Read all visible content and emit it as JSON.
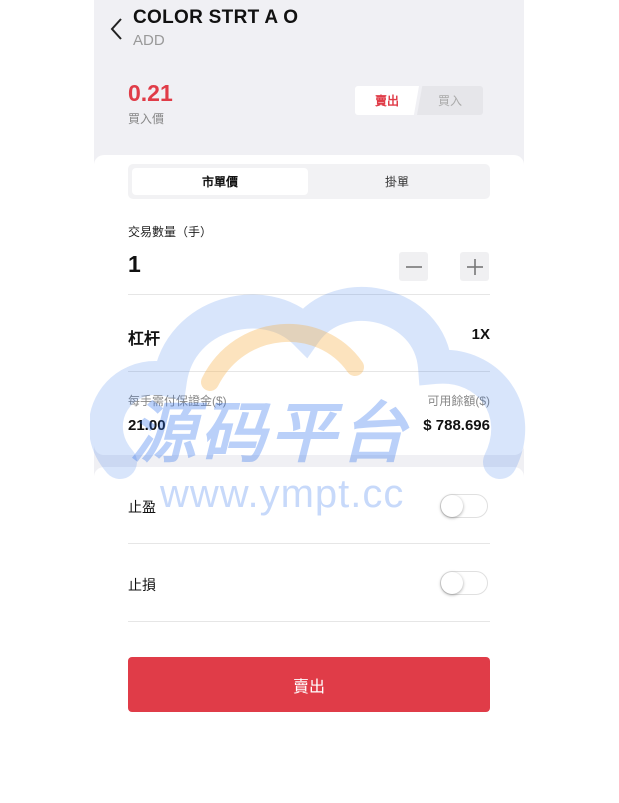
{
  "header": {
    "title": "COLOR STRT A O",
    "subtitle": "ADD"
  },
  "price": {
    "value": "0.21",
    "label": "買入價"
  },
  "side_toggle": {
    "sell": "賣出",
    "buy": "買入"
  },
  "order_tabs": {
    "market": "市單價",
    "limit": "掛單"
  },
  "quantity": {
    "label": "交易數量（手）",
    "value": "1"
  },
  "leverage": {
    "label": "杠杆",
    "value": "1X"
  },
  "margin": {
    "label": "每手需付保證金($)",
    "value": "21.00"
  },
  "available": {
    "label": "可用餘額($)",
    "value": "$ 788.696"
  },
  "take_profit": {
    "label": "止盈",
    "enabled": false
  },
  "stop_loss": {
    "label": "止損",
    "enabled": false
  },
  "submit": {
    "label": "賣出"
  },
  "watermark": {
    "brand": "源码平台",
    "url": "www.ympt.cc"
  },
  "colors": {
    "accent_red": "#e03c48",
    "background": "#f0f0f4",
    "muted_text": "#888888"
  }
}
